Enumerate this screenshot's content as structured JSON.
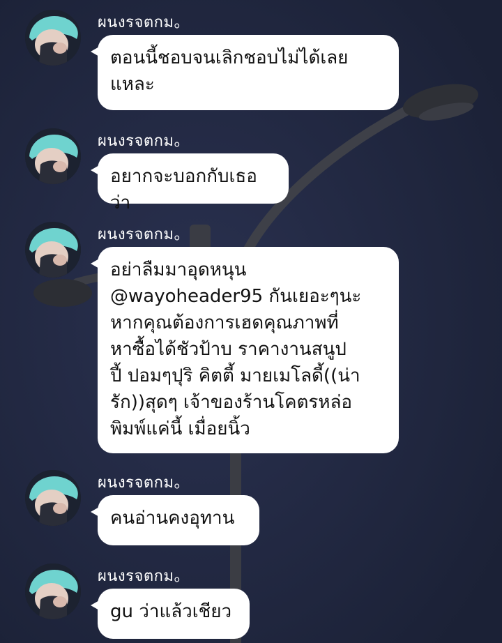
{
  "conversation": {
    "messages": [
      {
        "sender": "ผนงรจตกม。",
        "text": "ตอนนี้ชอบจนเลิกชอบไม่ได้เลย\nแหละ"
      },
      {
        "sender": "ผนงรจตกม。",
        "text": "อยากจะบอกกับเธอว่า"
      },
      {
        "sender": "ผนงรจตกม。",
        "text": "อย่าลืมมาอุดหนุน\n@wayoheader95 กันเยอะๆนะ\nหากคุณต้องการเฮดคุณภาพที่\nหาซื้อได้ชัวป้าบ ราคางานสนูป\nปี้ ปอมๆปุริ คิตตี้ มายเมโลดี้((น่า\nรัก))สุดๆ เจ้าของร้านโคตรหล่อ\nพิมพ์แค่นี้ เมื่อยนิ้ว"
      },
      {
        "sender": "ผนงรจตกม。",
        "text": "คนอ่านคงอุทาน"
      },
      {
        "sender": "ผนงรจตกม。",
        "text": "gu ว่าแล้วเชียว"
      }
    ]
  },
  "colors": {
    "background": "#1f2640",
    "bubble": "#ffffff",
    "sender_text": "#ffffff",
    "message_text": "#111111"
  }
}
